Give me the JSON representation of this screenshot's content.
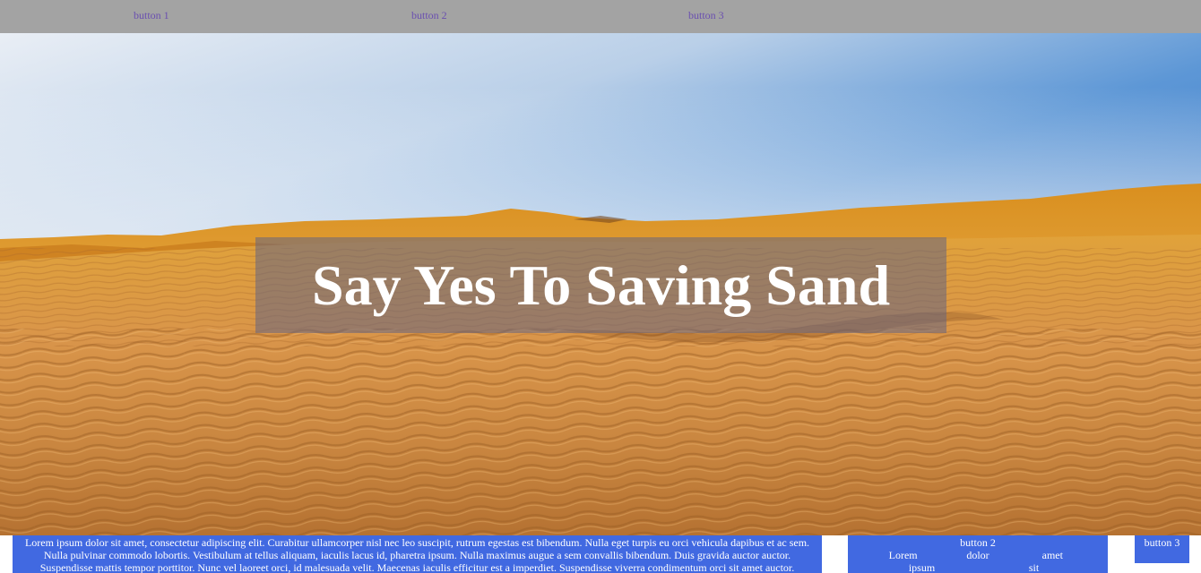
{
  "nav": {
    "button_1": "button 1",
    "button_2": "button 2",
    "button_3": "button 3"
  },
  "hero": {
    "title": "Say Yes To Saving Sand",
    "image": "desert-dunes-image"
  },
  "bottom": {
    "text": "Lorem ipsum dolor sit amet, consectetur adipiscing elit. Curabitur ullamcorper nisl nec leo suscipit, rutrum egestas est bibendum. Nulla eget turpis eu orci vehicula dapibus et ac sem. Nulla pulvinar commodo lobortis. Vestibulum at tellus aliquam, iaculis lacus id, pharetra ipsum. Nulla maximus augue a sem convallis bibendum. Duis gravida auctor auctor. Suspendisse mattis tempor porttitor. Nunc vel laoreet orci, id malesuada velit. Maecenas iaculis efficitur est a imperdiet. Suspendisse viverra condimentum orci sit amet auctor.",
    "panel2": {
      "button_label": "button 2",
      "words": [
        "Lorem",
        "dolor",
        "amet",
        "ipsum",
        "sit"
      ]
    },
    "panel3": {
      "button_label": "button 3"
    }
  },
  "colors": {
    "nav_bg": "#a3a3a3",
    "nav_link": "#6a4fb0",
    "panel_blue": "#4169e1"
  }
}
